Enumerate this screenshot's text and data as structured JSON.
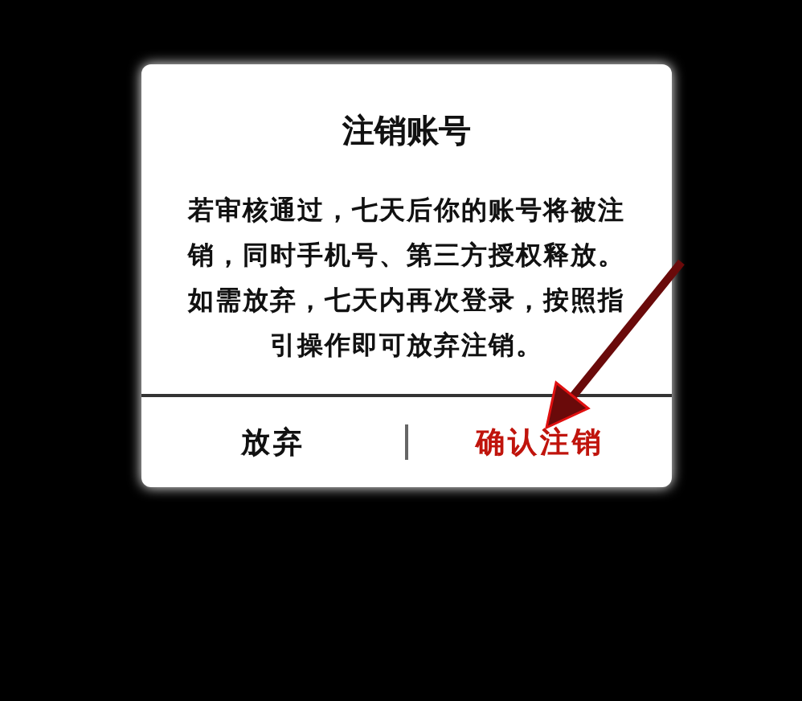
{
  "dialog": {
    "title": "注销账号",
    "message": "若审核通过，七天后你的账号将被注销，同时手机号、第三方授权释放。如需放弃，七天内再次登录，按照指引操作即可放弃注销。",
    "buttons": [
      {
        "label": "放弃",
        "kind": "cancel"
      },
      {
        "label": "确认注销",
        "kind": "danger"
      }
    ]
  }
}
